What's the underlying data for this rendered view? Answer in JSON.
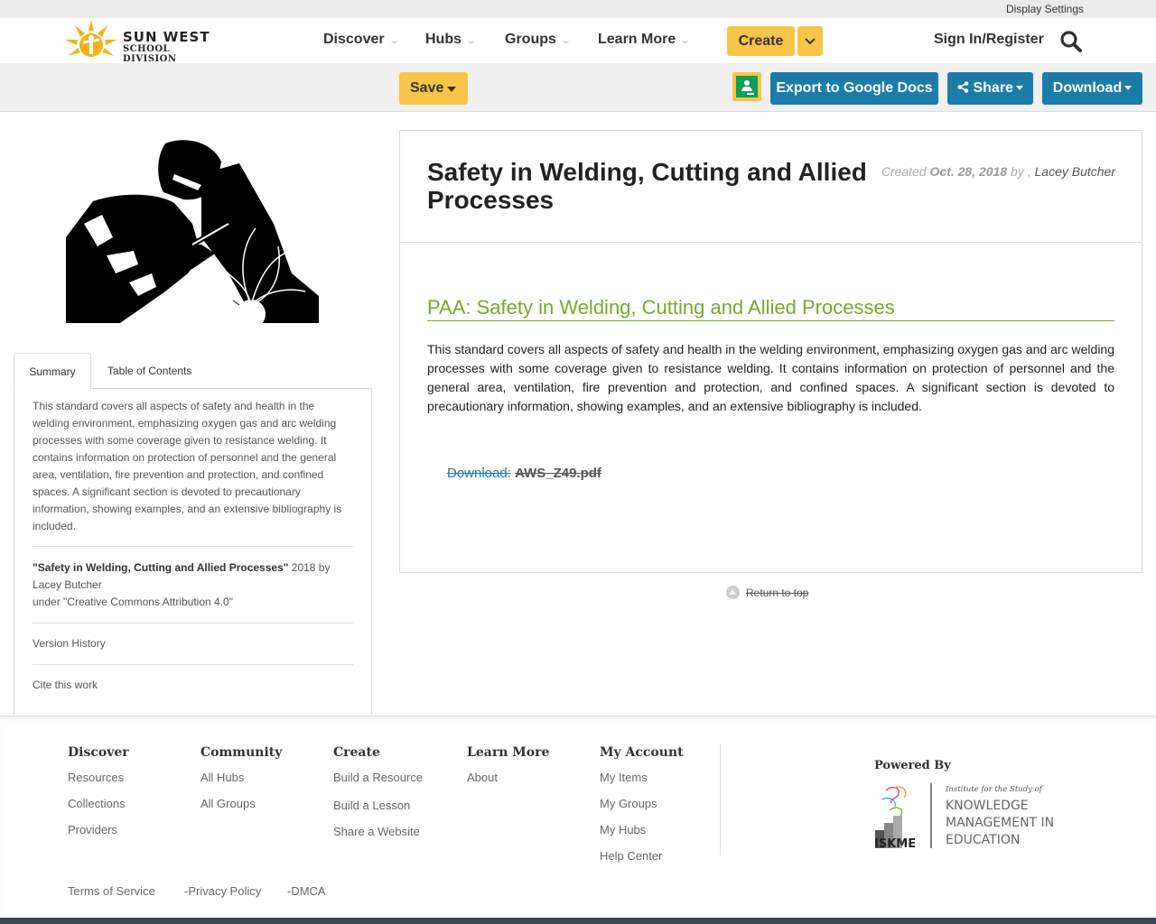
{
  "topbar": {
    "display_settings": "Display Settings"
  },
  "logo": {
    "name_line1": "SUN WEST",
    "name_line2": "SCHOOL DIVISION"
  },
  "nav": {
    "items": [
      "Discover",
      "Hubs",
      "Groups",
      "Learn More"
    ],
    "create": "Create",
    "signin": "Sign In/Register"
  },
  "toolbar": {
    "save": "Save",
    "export": "Export to Google Docs",
    "share": "Share",
    "download": "Download"
  },
  "tabs": {
    "summary": "Summary",
    "toc": "Table of Contents"
  },
  "sidebar": {
    "summary": "This standard covers all aspects of safety and health in the welding environment, emphasizing oxygen gas and arc welding processes with some coverage given to resistance welding. It contains information on protection of personnel and the general area, ventilation, fire prevention and protection, and confined spaces. A significant section is devoted to precautionary information, showing examples, and an extensive bibliography is included.",
    "attrib_title": "\"Safety in Welding, Cutting and Allied Processes\"",
    "attrib_by": " 2018 by Lacey Butcher",
    "attrib_license": "under \"Creative Commons Attribution 4.0\"",
    "version_history": "Version History",
    "cite": "Cite this work"
  },
  "doc": {
    "title": "Safety in Welding, Cutting and Allied Processes",
    "created_label": "Created",
    "created_date": "Oct. 28, 2018",
    "by": "by ,",
    "author": "Lacey Butcher",
    "section_title": "PAA: Safety in Welding, Cutting and Allied Processes",
    "body": "This standard covers all aspects of safety and health in the welding environment, emphasizing oxygen gas and arc welding processes with some coverage given to resistance welding. It contains information on protection of personnel and the general area, ventilation, fire prevention and protection, and confined spaces. A significant section is devoted to precautionary information, showing examples, and an extensive bibliography is included.",
    "download_label": "Download:",
    "download_file": "AWS_Z49.pdf",
    "return_top": "Return to top"
  },
  "footer": {
    "discover": {
      "title": "Discover",
      "links": [
        "Resources",
        "Collections",
        "Providers"
      ]
    },
    "community": {
      "title": "Community",
      "links": [
        "All Hubs",
        "All Groups"
      ]
    },
    "create": {
      "title": "Create",
      "links": [
        "Build a Resource",
        "Build a Lesson",
        "Share a Website"
      ]
    },
    "learn": {
      "title": "Learn More",
      "links": [
        "About"
      ]
    },
    "account": {
      "title": "My Account",
      "links": [
        "My Items",
        "My Groups",
        "My Hubs",
        "Help Center"
      ]
    },
    "powered_by": "Powered By",
    "iskme": {
      "line0": "Institute for the Study of",
      "line1": "KNOWLEDGE",
      "line2": "MANAGEMENT IN",
      "line3": "EDUCATION",
      "mark": "ISKME"
    },
    "legal": [
      "Terms of Service",
      "-Privacy Policy",
      "-DMCA"
    ]
  },
  "colors": {
    "accent_yellow": "#f7c547",
    "blue": "#1c7ca8",
    "green_link": "#79a72e"
  },
  "icons": [
    "search-icon",
    "chevron-down-icon",
    "google-classroom-icon",
    "share-icon",
    "caret-down-icon",
    "arrow-up-icon"
  ]
}
